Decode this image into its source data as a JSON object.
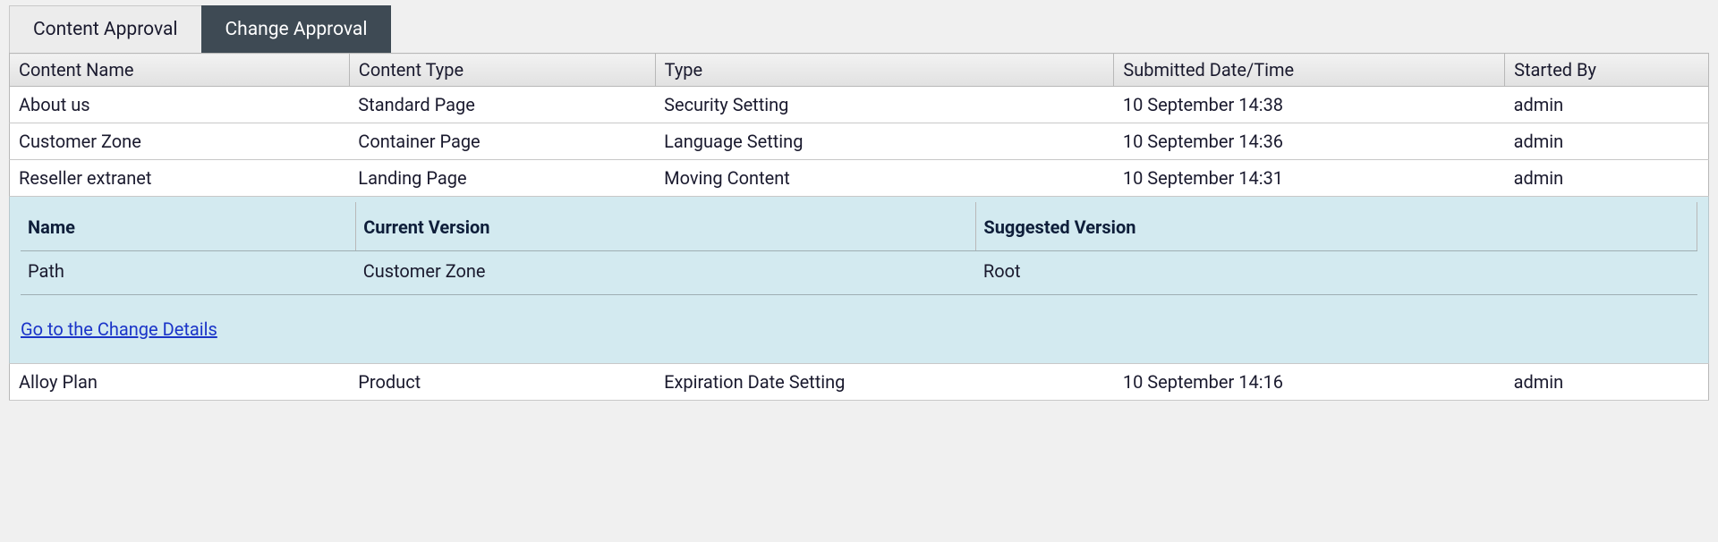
{
  "tabs": [
    {
      "label": "Content Approval",
      "active": false
    },
    {
      "label": "Change Approval",
      "active": true
    }
  ],
  "columns": {
    "content_name": "Content Name",
    "content_type": "Content Type",
    "type": "Type",
    "submitted": "Submitted Date/Time",
    "started_by": "Started By"
  },
  "rows": [
    {
      "content_name": "About us",
      "content_type": "Standard Page",
      "type": "Security Setting",
      "submitted": "10 September 14:38",
      "started_by": "admin"
    },
    {
      "content_name": "Customer Zone",
      "content_type": "Container Page",
      "type": "Language Setting",
      "submitted": "10 September 14:36",
      "started_by": "admin"
    },
    {
      "content_name": "Reseller extranet",
      "content_type": "Landing Page",
      "type": "Moving Content",
      "submitted": "10 September 14:31",
      "started_by": "admin"
    },
    {
      "content_name": "Alloy Plan",
      "content_type": "Product",
      "type": "Expiration Date Setting",
      "submitted": "10 September 14:16",
      "started_by": "admin"
    }
  ],
  "detail": {
    "columns": {
      "name": "Name",
      "current": "Current Version",
      "suggested": "Suggested Version"
    },
    "row": {
      "name": "Path",
      "current": "Customer Zone",
      "suggested": "Root"
    },
    "link_label": "Go to the Change Details"
  }
}
